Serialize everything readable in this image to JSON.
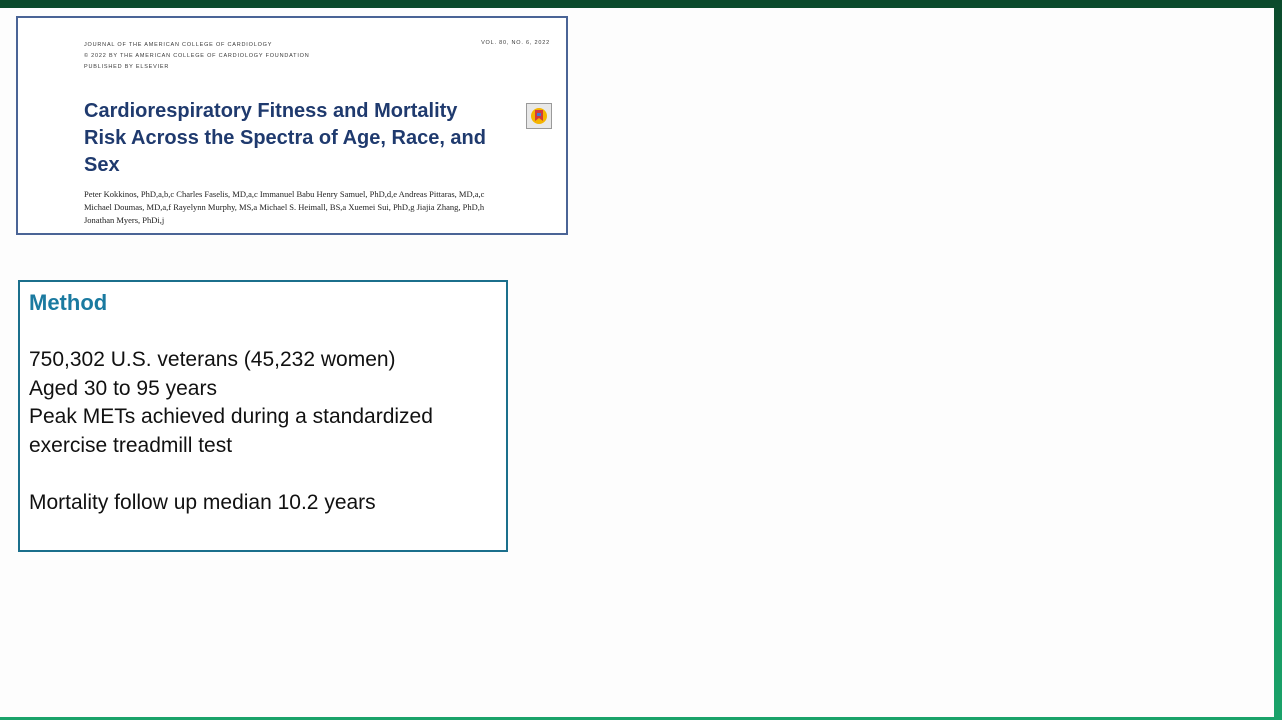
{
  "paper": {
    "journal_line_1": "JOURNAL OF THE AMERICAN COLLEGE OF CARDIOLOGY",
    "journal_line_2": "© 2022 BY THE AMERICAN COLLEGE OF CARDIOLOGY FOUNDATION",
    "journal_line_3": "PUBLISHED BY ELSEVIER",
    "volume": "VOL. 80, NO. 6, 2022",
    "title": "Cardiorespiratory Fitness and Mortality Risk Across the Spectra of Age, Race, and Sex",
    "authors_line_1": "Peter Kokkinos, PhD,a,b,c Charles Faselis, MD,a,c Immanuel Babu Henry Samuel, PhD,d,e Andreas Pittaras, MD,a,c",
    "authors_line_2": "Michael Doumas, MD,a,f Rayelynn Murphy, MS,a Michael S. Heimall, BS,a Xuemei Sui, PhD,g Jiajia Zhang, PhD,h",
    "authors_line_3": "Jonathan Myers, PhDi,j",
    "badge_icon": "crossmark-icon"
  },
  "method": {
    "heading": "Method",
    "line_1": "750,302 U.S. veterans (45,232 women)",
    "line_2": "Aged 30 to 95 years",
    "line_3": "Peak METs achieved during a standardized exercise treadmill test",
    "line_4": "Mortality follow up median 10.2 years"
  },
  "colors": {
    "background_green": "#117a4a",
    "paper_border": "#4a6496",
    "paper_title": "#1f3a6e",
    "method_border": "#1b6f8c",
    "method_heading": "#1a7aa0"
  }
}
